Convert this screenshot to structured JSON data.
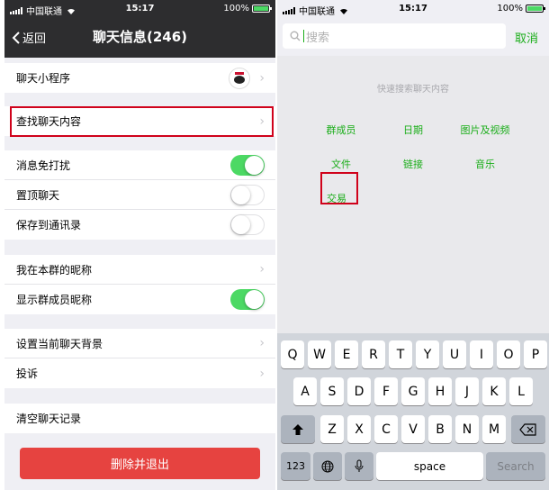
{
  "left": {
    "status": {
      "carrier": "中国联通",
      "time": "15:17",
      "battery": "100%",
      "battery_level": 1.0
    },
    "nav": {
      "back_label": "返回",
      "title": "聊天信息(246)"
    },
    "rows": {
      "mini_programs": "聊天小程序",
      "find_content": "查找聊天内容",
      "mute": "消息免打扰",
      "sticky": "置顶聊天",
      "save_contacts": "保存到通讯录",
      "my_nickname": "我在本群的昵称",
      "show_nicknames": "显示群成员昵称",
      "set_background": "设置当前聊天背景",
      "report": "投诉",
      "clear_history": "清空聊天记录"
    },
    "toggles": {
      "mute": true,
      "sticky": false,
      "save_contacts": false,
      "show_nicknames": true
    },
    "delete_button": "删除并退出"
  },
  "right": {
    "status": {
      "carrier": "中国联通",
      "time": "15:17",
      "battery": "100%",
      "battery_level": 1.0
    },
    "search": {
      "placeholder": "搜索",
      "cancel": "取消"
    },
    "hint": "快速搜索聊天内容",
    "categories": [
      [
        "群成员",
        "日期",
        "图片及视频"
      ],
      [
        "文件",
        "链接",
        "音乐"
      ],
      [
        "交易"
      ]
    ],
    "keyboard": {
      "row1": [
        "Q",
        "W",
        "E",
        "R",
        "T",
        "Y",
        "U",
        "I",
        "O",
        "P"
      ],
      "row2": [
        "A",
        "S",
        "D",
        "F",
        "G",
        "H",
        "J",
        "K",
        "L"
      ],
      "row3": [
        "Z",
        "X",
        "C",
        "V",
        "B",
        "N",
        "M"
      ],
      "numbers": "123",
      "space": "space",
      "search": "Search"
    }
  },
  "colors": {
    "accent_green": "#1aad19",
    "danger": "#e64340",
    "highlight_red": "#d0021b",
    "switch_on": "#4cd964"
  },
  "icons": [
    "chevron-left-icon",
    "wifi-icon",
    "battery-icon",
    "chevron-right-icon",
    "search-icon",
    "globe-icon",
    "microphone-icon",
    "shift-icon",
    "backspace-icon"
  ]
}
